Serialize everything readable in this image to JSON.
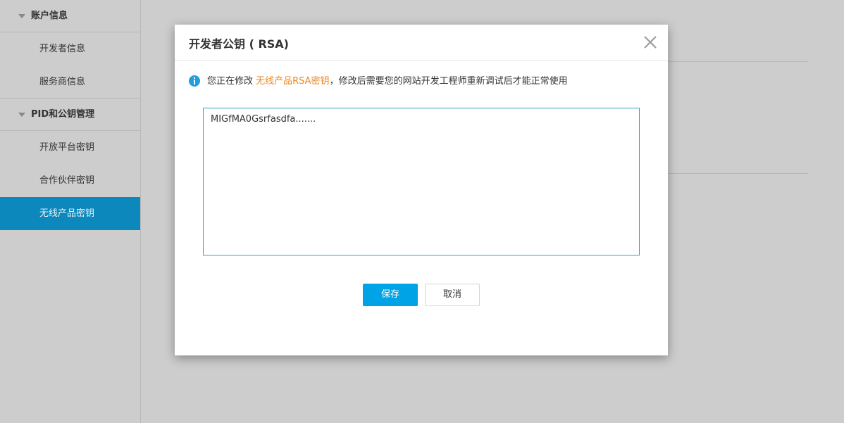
{
  "sidebar": {
    "groups": [
      {
        "title": "账户信息",
        "items": [
          "开发者信息",
          "服务商信息"
        ]
      },
      {
        "title": "PID和公钥管理",
        "items": [
          "开放平台密钥",
          "合作伙伴密钥",
          "无线产品密钥"
        ]
      }
    ],
    "active_item": "无线产品密钥"
  },
  "modal": {
    "title": "开发者公钥 ( RSA)",
    "notice_prefix": "您正在修改 ",
    "notice_highlight": "无线产品RSA密钥",
    "notice_suffix": "，修改后需要您的网站开发工程师重新调试后才能正常使用",
    "key_value": "MIGfMA0Gsrfasdfa.......",
    "save_label": "保存",
    "cancel_label": "取消"
  },
  "colors": {
    "overlay_bg": "#cdcdcd",
    "active_nav": "#0c88bd",
    "primary_button": "#00a3e6",
    "highlight_text": "#f08519",
    "info_icon": "#1f9fe0"
  }
}
